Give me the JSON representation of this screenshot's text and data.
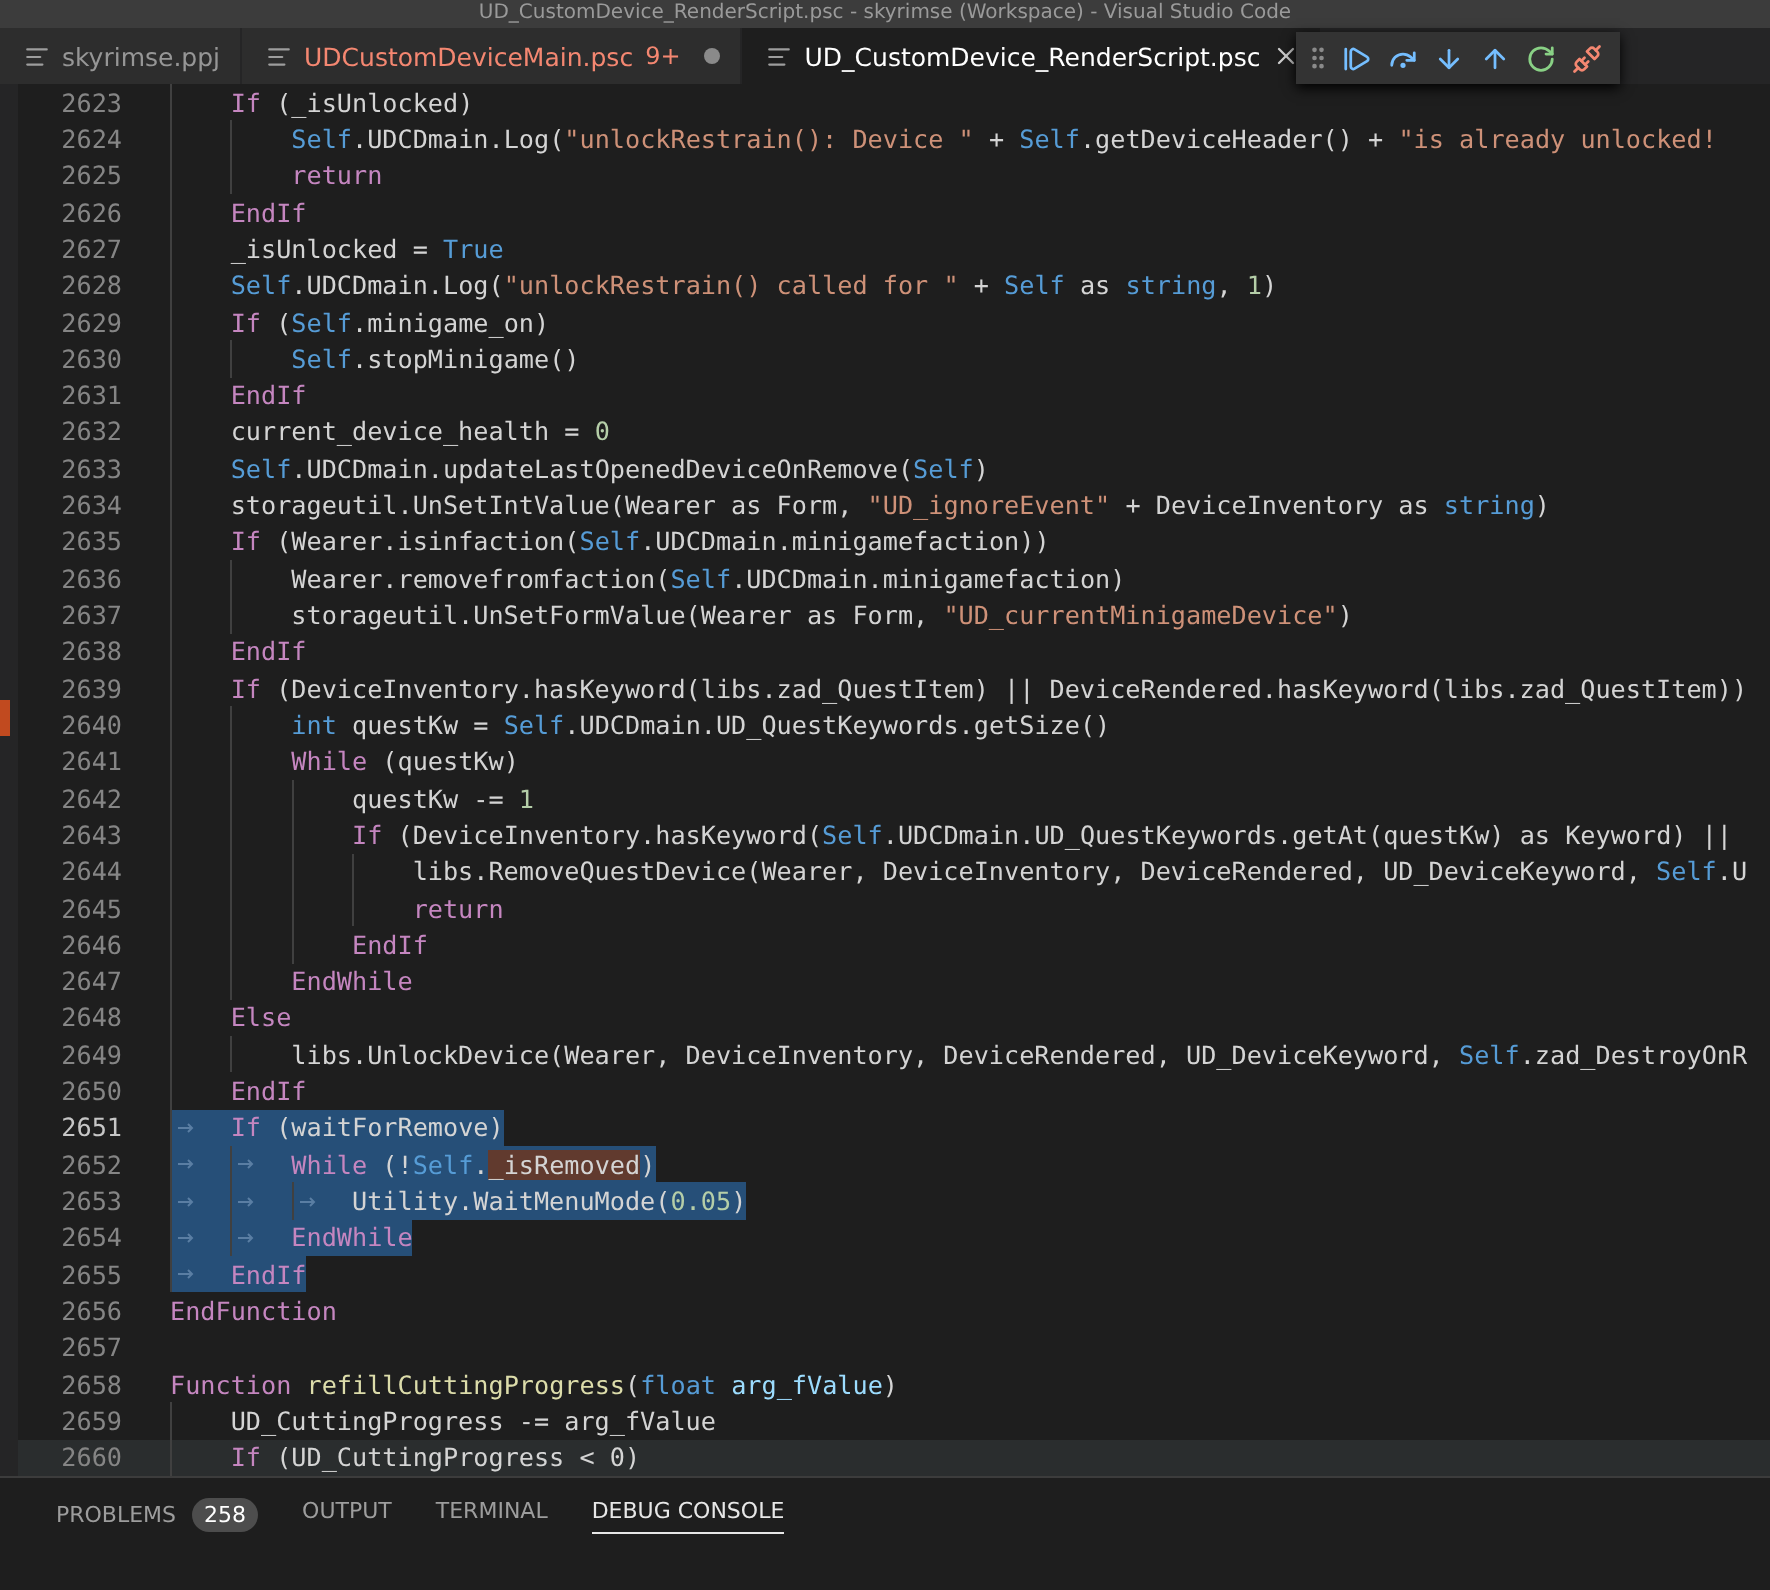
{
  "window": {
    "title": "UD_CustomDevice_RenderScript.psc - skyrimse (Workspace) - Visual Studio Code"
  },
  "tabs": [
    {
      "label": "skyrimse.ppj",
      "selected": false,
      "modified": false,
      "problems": false
    },
    {
      "label": "UDCustomDeviceMain.psc",
      "badge": "9+",
      "selected": false,
      "modified": true,
      "problems": true
    },
    {
      "label": "UD_CustomDevice_RenderScript.psc",
      "selected": true,
      "modified": false,
      "problems": false
    }
  ],
  "debug_toolbar": {
    "buttons": [
      {
        "kind": "continue"
      },
      {
        "kind": "step_over"
      },
      {
        "kind": "step_into"
      },
      {
        "kind": "step_out"
      },
      {
        "kind": "restart"
      },
      {
        "kind": "disconnect"
      }
    ]
  },
  "editor": {
    "lines": [
      {
        "children": [
          {
            "number": "2623",
            "selected": false,
            "active": false,
            "hovered": false,
            "tokens": [
              {
                "kind": "kw",
                "text": "If"
              },
              {
                "kind": "p",
                "text": " (_isUnlocked)"
              }
            ],
            "children": [
              {
                "number": "2624",
                "selected": false,
                "active": false,
                "hovered": false,
                "tokens": [
                  {
                    "kind": "self",
                    "text": "Self"
                  },
                  {
                    "kind": "p",
                    "text": ".UDCDmain.Log("
                  },
                  {
                    "kind": "str",
                    "text": "\"unlockRestrain(): Device \""
                  },
                  {
                    "kind": "p",
                    "text": " + "
                  },
                  {
                    "kind": "self",
                    "text": "Self"
                  },
                  {
                    "kind": "p",
                    "text": ".getDeviceHeader() + "
                  },
                  {
                    "kind": "str",
                    "text": "\"is already unlocked!"
                  }
                ]
              },
              {
                "number": "2625",
                "selected": false,
                "active": false,
                "hovered": false,
                "tokens": [
                  {
                    "kind": "kw",
                    "text": "return"
                  }
                ]
              }
            ]
          },
          {
            "number": "2626",
            "selected": false,
            "active": false,
            "hovered": false,
            "tokens": [
              {
                "kind": "kw",
                "text": "EndIf"
              }
            ]
          },
          {
            "number": "2627",
            "selected": false,
            "active": false,
            "hovered": false,
            "tokens": [
              {
                "kind": "p",
                "text": "_isUnlocked = "
              },
              {
                "kind": "self",
                "text": "True"
              }
            ]
          },
          {
            "number": "2628",
            "selected": false,
            "active": false,
            "hovered": false,
            "tokens": [
              {
                "kind": "self",
                "text": "Self"
              },
              {
                "kind": "p",
                "text": ".UDCDmain.Log("
              },
              {
                "kind": "str",
                "text": "\"unlockRestrain() called for \""
              },
              {
                "kind": "p",
                "text": " + "
              },
              {
                "kind": "self",
                "text": "Self"
              },
              {
                "kind": "p",
                "text": " as "
              },
              {
                "kind": "self",
                "text": "string"
              },
              {
                "kind": "p",
                "text": ", "
              },
              {
                "kind": "num",
                "text": "1"
              },
              {
                "kind": "p",
                "text": ")"
              }
            ]
          },
          {
            "number": "2629",
            "selected": false,
            "active": false,
            "hovered": false,
            "tokens": [
              {
                "kind": "kw",
                "text": "If"
              },
              {
                "kind": "p",
                "text": " ("
              },
              {
                "kind": "self",
                "text": "Self"
              },
              {
                "kind": "p",
                "text": ".minigame_on)"
              }
            ],
            "children": [
              {
                "number": "2630",
                "selected": false,
                "active": false,
                "hovered": false,
                "tokens": [
                  {
                    "kind": "self",
                    "text": "Self"
                  },
                  {
                    "kind": "p",
                    "text": ".stopMinigame()"
                  }
                ]
              }
            ]
          },
          {
            "number": "2631",
            "selected": false,
            "active": false,
            "hovered": false,
            "tokens": [
              {
                "kind": "kw",
                "text": "EndIf"
              }
            ]
          },
          {
            "number": "2632",
            "selected": false,
            "active": false,
            "hovered": false,
            "tokens": [
              {
                "kind": "p",
                "text": "current_device_health = "
              },
              {
                "kind": "num",
                "text": "0"
              }
            ]
          },
          {
            "number": "2633",
            "selected": false,
            "active": false,
            "hovered": false,
            "tokens": [
              {
                "kind": "self",
                "text": "Self"
              },
              {
                "kind": "p",
                "text": ".UDCDmain.updateLastOpenedDeviceOnRemove("
              },
              {
                "kind": "self",
                "text": "Self"
              },
              {
                "kind": "p",
                "text": ")"
              }
            ]
          },
          {
            "number": "2634",
            "selected": false,
            "active": false,
            "hovered": false,
            "tokens": [
              {
                "kind": "p",
                "text": "storageutil.UnSetIntValue(Wearer as Form, "
              },
              {
                "kind": "str",
                "text": "\"UD_ignoreEvent\""
              },
              {
                "kind": "p",
                "text": " + DeviceInventory as "
              },
              {
                "kind": "self",
                "text": "string"
              },
              {
                "kind": "p",
                "text": ")"
              }
            ]
          },
          {
            "number": "2635",
            "selected": false,
            "active": false,
            "hovered": false,
            "tokens": [
              {
                "kind": "kw",
                "text": "If"
              },
              {
                "kind": "p",
                "text": " (Wearer.isinfaction("
              },
              {
                "kind": "self",
                "text": "Self"
              },
              {
                "kind": "p",
                "text": ".UDCDmain.minigamefaction))"
              }
            ],
            "children": [
              {
                "number": "2636",
                "selected": false,
                "active": false,
                "hovered": false,
                "tokens": [
                  {
                    "kind": "p",
                    "text": "Wearer.removefromfaction("
                  },
                  {
                    "kind": "self",
                    "text": "Self"
                  },
                  {
                    "kind": "p",
                    "text": ".UDCDmain.minigamefaction)"
                  }
                ]
              },
              {
                "number": "2637",
                "selected": false,
                "active": false,
                "hovered": false,
                "tokens": [
                  {
                    "kind": "p",
                    "text": "storageutil.UnSetFormValue(Wearer as Form, "
                  },
                  {
                    "kind": "str",
                    "text": "\"UD_currentMinigameDevice\""
                  },
                  {
                    "kind": "p",
                    "text": ")"
                  }
                ]
              }
            ]
          },
          {
            "number": "2638",
            "selected": false,
            "active": false,
            "hovered": false,
            "tokens": [
              {
                "kind": "kw",
                "text": "EndIf"
              }
            ]
          },
          {
            "number": "2639",
            "selected": false,
            "active": false,
            "hovered": false,
            "tokens": [
              {
                "kind": "kw",
                "text": "If"
              },
              {
                "kind": "p",
                "text": " (DeviceInventory.hasKeyword(libs.zad_QuestItem) || DeviceRendered.hasKeyword(libs.zad_QuestItem))"
              }
            ],
            "children": [
              {
                "number": "2640",
                "selected": false,
                "active": false,
                "hovered": false,
                "tokens": [
                  {
                    "kind": "self",
                    "text": "int"
                  },
                  {
                    "kind": "p",
                    "text": " questKw = "
                  },
                  {
                    "kind": "self",
                    "text": "Self"
                  },
                  {
                    "kind": "p",
                    "text": ".UDCDmain.UD_QuestKeywords.getSize()"
                  }
                ]
              },
              {
                "number": "2641",
                "selected": false,
                "active": false,
                "hovered": false,
                "tokens": [
                  {
                    "kind": "kw",
                    "text": "While"
                  },
                  {
                    "kind": "p",
                    "text": " (questKw)"
                  }
                ],
                "children": [
                  {
                    "number": "2642",
                    "selected": false,
                    "active": false,
                    "hovered": false,
                    "tokens": [
                      {
                        "kind": "p",
                        "text": "questKw -= "
                      },
                      {
                        "kind": "num",
                        "text": "1"
                      }
                    ]
                  },
                  {
                    "number": "2643",
                    "selected": false,
                    "active": false,
                    "hovered": false,
                    "tokens": [
                      {
                        "kind": "kw",
                        "text": "If"
                      },
                      {
                        "kind": "p",
                        "text": " (DeviceInventory.hasKeyword("
                      },
                      {
                        "kind": "self",
                        "text": "Self"
                      },
                      {
                        "kind": "p",
                        "text": ".UDCDmain.UD_QuestKeywords.getAt(questKw) as Keyword) ||"
                      }
                    ],
                    "children": [
                      {
                        "number": "2644",
                        "selected": false,
                        "active": false,
                        "hovered": false,
                        "tokens": [
                          {
                            "kind": "p",
                            "text": "libs.RemoveQuestDevice(Wearer, DeviceInventory, DeviceRendered, UD_DeviceKeyword, "
                          },
                          {
                            "kind": "self",
                            "text": "Self"
                          },
                          {
                            "kind": "p",
                            "text": ".U"
                          }
                        ]
                      },
                      {
                        "number": "2645",
                        "selected": false,
                        "active": false,
                        "hovered": false,
                        "tokens": [
                          {
                            "kind": "kw",
                            "text": "return"
                          }
                        ]
                      }
                    ]
                  },
                  {
                    "number": "2646",
                    "selected": false,
                    "active": false,
                    "hovered": false,
                    "tokens": [
                      {
                        "kind": "kw",
                        "text": "EndIf"
                      }
                    ]
                  }
                ]
              },
              {
                "number": "2647",
                "selected": false,
                "active": false,
                "hovered": false,
                "tokens": [
                  {
                    "kind": "kw",
                    "text": "EndWhile"
                  }
                ]
              }
            ]
          },
          {
            "number": "2648",
            "selected": false,
            "active": false,
            "hovered": false,
            "tokens": [
              {
                "kind": "kw",
                "text": "Else"
              }
            ],
            "children": [
              {
                "number": "2649",
                "selected": false,
                "active": false,
                "hovered": false,
                "tokens": [
                  {
                    "kind": "p",
                    "text": "libs.UnlockDevice(Wearer, DeviceInventory, DeviceRendered, UD_DeviceKeyword, "
                  },
                  {
                    "kind": "self",
                    "text": "Self"
                  },
                  {
                    "kind": "p",
                    "text": ".zad_DestroyOnR"
                  }
                ]
              }
            ]
          },
          {
            "number": "2650",
            "selected": false,
            "active": false,
            "hovered": false,
            "tokens": [
              {
                "kind": "kw",
                "text": "EndIf"
              }
            ]
          },
          {
            "number": "2651",
            "selected": true,
            "active": true,
            "hovered": false,
            "tokens": [
              {
                "kind": "kw",
                "text": "If"
              },
              {
                "kind": "p",
                "text": " (waitForRemove)"
              }
            ],
            "children": [
              {
                "number": "2652",
                "selected": true,
                "active": false,
                "hovered": false,
                "tokens": [
                  {
                    "kind": "kw",
                    "text": "While"
                  },
                  {
                    "kind": "p",
                    "text": " (!"
                  },
                  {
                    "kind": "self",
                    "text": "Self"
                  },
                  {
                    "kind": "p",
                    "text": "."
                  },
                  {
                    "kind": "match",
                    "text": "_isRemoved"
                  },
                  {
                    "kind": "p",
                    "text": ")"
                  }
                ],
                "children": [
                  {
                    "number": "2653",
                    "selected": true,
                    "active": false,
                    "hovered": false,
                    "tokens": [
                      {
                        "kind": "p",
                        "text": "Utility.WaitMenuMode("
                      },
                      {
                        "kind": "num",
                        "text": "0.05"
                      },
                      {
                        "kind": "p",
                        "text": ")"
                      }
                    ]
                  }
                ]
              },
              {
                "number": "2654",
                "selected": true,
                "active": false,
                "hovered": false,
                "tokens": [
                  {
                    "kind": "kw",
                    "text": "EndWhile"
                  }
                ]
              }
            ]
          },
          {
            "number": "2655",
            "selected": true,
            "active": false,
            "hovered": false,
            "tokens": [
              {
                "kind": "kw",
                "text": "EndIf"
              }
            ]
          }
        ]
      },
      {
        "number": "2656",
        "selected": false,
        "active": false,
        "hovered": false,
        "tokens": [
          {
            "kind": "kw",
            "text": "EndFunction"
          }
        ]
      },
      {
        "number": "2657",
        "selected": false,
        "active": false,
        "hovered": false
      },
      {
        "number": "2658",
        "selected": false,
        "active": false,
        "hovered": false,
        "tokens": [
          {
            "kind": "kw",
            "text": "Function"
          },
          {
            "kind": "fn",
            "text": " refillCuttingProgress"
          },
          {
            "kind": "p",
            "text": "("
          },
          {
            "kind": "self",
            "text": "float"
          },
          {
            "kind": "param",
            "text": " arg_fValue"
          },
          {
            "kind": "p",
            "text": ")"
          }
        ],
        "children": [
          {
            "number": "2659",
            "selected": false,
            "active": false,
            "hovered": false,
            "tokens": [
              {
                "kind": "p",
                "text": "UD_CuttingProgress -= arg_fValue"
              }
            ]
          },
          {
            "number": "2660",
            "selected": false,
            "active": false,
            "hovered": true,
            "tokens": [
              {
                "kind": "kw",
                "text": "If"
              },
              {
                "kind": "p",
                "text": " (UD_CuttingProgress < 0)"
              }
            ]
          }
        ]
      }
    ]
  },
  "panel": {
    "tabs": [
      {
        "label": "PROBLEMS",
        "badge": "258",
        "selected": false
      },
      {
        "label": "OUTPUT",
        "selected": false
      },
      {
        "label": "TERMINAL",
        "selected": false
      },
      {
        "label": "DEBUG CONSOLE",
        "selected": true
      }
    ]
  }
}
